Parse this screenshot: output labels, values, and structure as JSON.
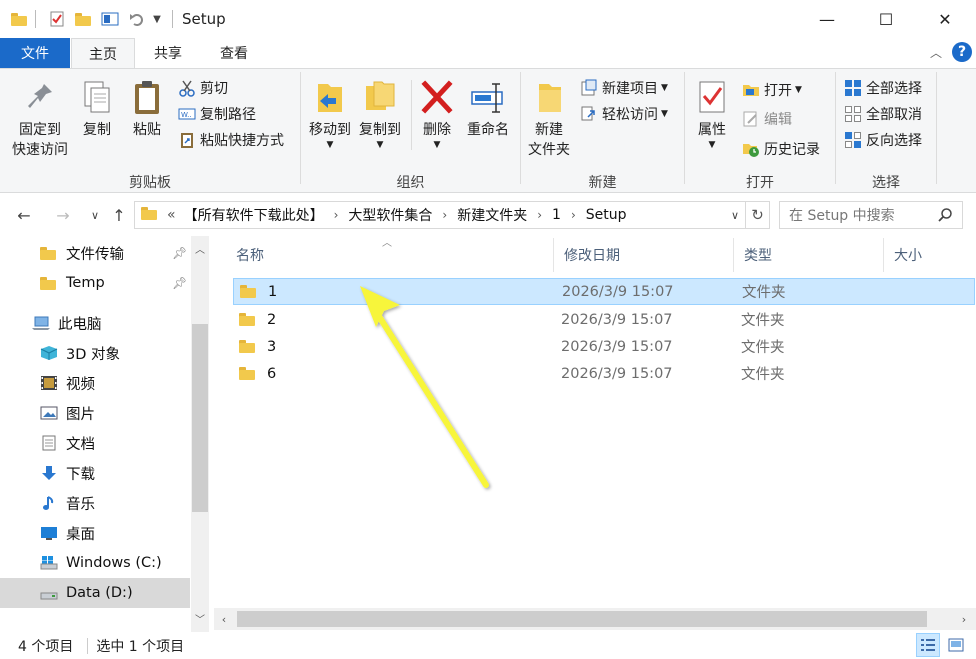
{
  "window": {
    "title": "Setup",
    "minimize_glyph": "—",
    "maximize_glyph": "☐",
    "close_glyph": "✕"
  },
  "ribbon_tabs": [
    {
      "label": "文件"
    },
    {
      "label": "主页"
    },
    {
      "label": "共享"
    },
    {
      "label": "查看"
    }
  ],
  "help_label": "?",
  "clipboard": {
    "group_label": "剪贴板",
    "pin_line1": "固定到",
    "pin_line2": "快速访问",
    "copy": "复制",
    "paste": "粘贴",
    "cut": "剪切",
    "copy_path": "复制路径",
    "paste_shortcut": "粘贴快捷方式"
  },
  "organize": {
    "group_label": "组织",
    "move_to": "移动到",
    "copy_to": "复制到",
    "delete": "删除",
    "rename": "重命名"
  },
  "new_group": {
    "group_label": "新建",
    "new_folder_line1": "新建",
    "new_folder_line2": "文件夹",
    "new_item": "新建项目",
    "easy_access": "轻松访问"
  },
  "open_group": {
    "group_label": "打开",
    "properties": "属性",
    "open": "打开",
    "edit": "编辑",
    "history": "历史记录"
  },
  "select_group": {
    "group_label": "选择",
    "select_all": "全部选择",
    "select_none": "全部取消",
    "invert": "反向选择"
  },
  "address": {
    "overflow": "«",
    "crumbs": [
      "【所有软件下载此处】",
      "大型软件集合",
      "新建文件夹",
      "1",
      "Setup"
    ],
    "search_placeholder": "在 Setup 中搜索"
  },
  "sidebar": {
    "items": [
      {
        "label": "文件传输",
        "icon": "folder-icon",
        "pinned": true
      },
      {
        "label": "Temp",
        "icon": "folder-icon",
        "pinned": true
      },
      {
        "label": "此电脑",
        "icon": "computer-icon"
      },
      {
        "label": "3D 对象",
        "icon": "cube-icon"
      },
      {
        "label": "视频",
        "icon": "video-icon"
      },
      {
        "label": "图片",
        "icon": "picture-icon"
      },
      {
        "label": "文档",
        "icon": "document-icon"
      },
      {
        "label": "下载",
        "icon": "download-icon"
      },
      {
        "label": "音乐",
        "icon": "music-icon"
      },
      {
        "label": "桌面",
        "icon": "desktop-icon"
      },
      {
        "label": "Windows (C:)",
        "icon": "drive-c-icon"
      },
      {
        "label": "Data (D:)",
        "icon": "drive-d-icon"
      }
    ]
  },
  "columns": {
    "name": "名称",
    "date": "修改日期",
    "type": "类型",
    "size": "大小"
  },
  "files": [
    {
      "name": "1",
      "date": "2026/3/9 15:07",
      "type": "文件夹",
      "selected": true
    },
    {
      "name": "2",
      "date": "2026/3/9 15:07",
      "type": "文件夹"
    },
    {
      "name": "3",
      "date": "2026/3/9 15:07",
      "type": "文件夹"
    },
    {
      "name": "6",
      "date": "2026/3/9 15:07",
      "type": "文件夹"
    }
  ],
  "status": {
    "item_count": "4 个项目",
    "selected": "选中 1 个项目"
  },
  "colors": {
    "accent": "#1b6ac9",
    "selection": "#cce8ff",
    "folder": "#f2c94c",
    "arrow": "#f7f53a"
  }
}
